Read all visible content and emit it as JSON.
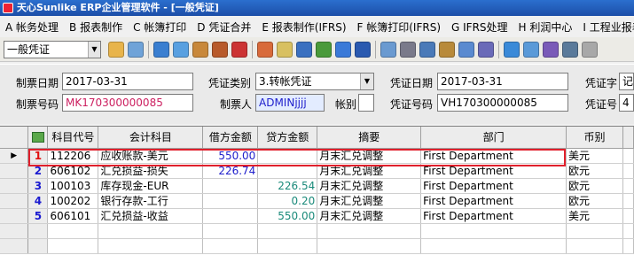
{
  "title": "天心Sunlike ERP企业管理软件 - [一般凭证]",
  "menu": [
    "A 帐务处理",
    "B 报表制作",
    "C 帐簿打印",
    "D 凭证合并",
    "E 报表制作(IFRS)",
    "F 帐簿打印(IFRS)",
    "G IFRS处理",
    "H 利润中心",
    "I 工程业报表"
  ],
  "toolbar": {
    "doc_type": "一般凭证",
    "icons": [
      {
        "name": "new-icon",
        "color": "#e8b44a"
      },
      {
        "name": "copy-icon",
        "color": "#6fa3d8"
      },
      {
        "name": "web-icon",
        "color": "#3a7fd0"
      },
      {
        "name": "chat-icon",
        "color": "#58a0e0"
      },
      {
        "name": "box-icon",
        "color": "#c8883a"
      },
      {
        "name": "briefcase-icon",
        "color": "#b85a2a"
      },
      {
        "name": "graduate-icon",
        "color": "#cc3333"
      },
      {
        "name": "people-icon",
        "color": "#d86a3a"
      },
      {
        "name": "envelope-icon",
        "color": "#d8c060"
      },
      {
        "name": "flag-icon",
        "color": "#3a70c0"
      },
      {
        "name": "arrow-icon",
        "color": "#4a9a3a"
      },
      {
        "name": "help-icon",
        "color": "#3a7ad8"
      },
      {
        "name": "stop-icon",
        "color": "#2a5ab0"
      },
      {
        "name": "attach-icon",
        "color": "#6a9ad0"
      },
      {
        "name": "print-icon",
        "color": "#7a7a8a"
      },
      {
        "name": "document-icon",
        "color": "#4a7ab8"
      },
      {
        "name": "lock-icon",
        "color": "#b88a3a"
      },
      {
        "name": "table-icon",
        "color": "#5a8ad0"
      },
      {
        "name": "chart-icon",
        "color": "#6a6ab8"
      },
      {
        "name": "check-icon",
        "color": "#3a8ad8"
      },
      {
        "name": "export-icon",
        "color": "#5a9ad8"
      },
      {
        "name": "cube-icon",
        "color": "#7a5ab8"
      },
      {
        "name": "settings-icon",
        "color": "#5a7a9a"
      },
      {
        "name": "close-icon",
        "color": "#a8a8a8"
      }
    ]
  },
  "header": {
    "create_date_label": "制票日期",
    "create_date": "2017-03-31",
    "create_no_label": "制票号码",
    "create_no": "MK170300000085",
    "voucher_type_label": "凭证类别",
    "voucher_type": "3.转帐凭证",
    "creator_label": "制票人",
    "creator": "ADMINjjjj",
    "book_label": "帐别",
    "book": "",
    "voucher_date_label": "凭证日期",
    "voucher_date": "2017-03-31",
    "voucher_no_label": "凭证号码",
    "voucher_no": "VH170300000085",
    "voucher_word_label": "凭证字",
    "voucher_word": "记",
    "voucher_num_label": "凭证号",
    "voucher_num": "4"
  },
  "grid": {
    "columns": [
      "",
      "科目代号",
      "会计科目",
      "借方金额",
      "贷方金额",
      "摘要",
      "部门",
      "币别"
    ],
    "rows": [
      {
        "num": "1",
        "code": "112206",
        "account": "应收账款-美元",
        "debit": "550.00",
        "credit": "",
        "summary": "月末汇兑调整",
        "dept": "First Department",
        "currency": "美元"
      },
      {
        "num": "2",
        "code": "606102",
        "account": "汇兑损益-损失",
        "debit": "226.74",
        "credit": "",
        "summary": "月末汇兑调整",
        "dept": "First Department",
        "currency": "欧元"
      },
      {
        "num": "3",
        "code": "100103",
        "account": "库存现金-EUR",
        "debit": "",
        "credit": "226.54",
        "summary": "月末汇兑调整",
        "dept": "First Department",
        "currency": "欧元"
      },
      {
        "num": "4",
        "code": "100202",
        "account": "银行存款-工行",
        "debit": "",
        "credit": "0.20",
        "summary": "月末汇兑调整",
        "dept": "First Department",
        "currency": "欧元"
      },
      {
        "num": "5",
        "code": "606101",
        "account": "汇兑损益-收益",
        "debit": "",
        "credit": "550.00",
        "summary": "月末汇兑调整",
        "dept": "First Department",
        "currency": "美元"
      }
    ]
  }
}
